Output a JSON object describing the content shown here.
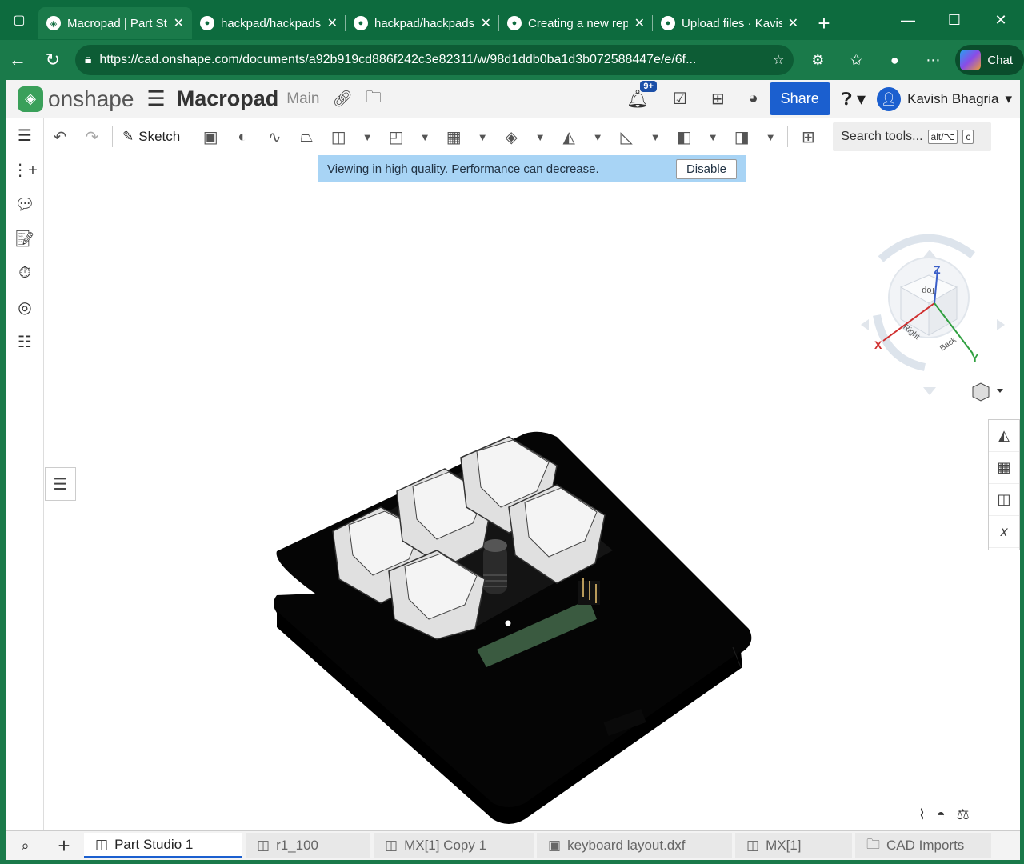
{
  "browser": {
    "tabs": [
      {
        "title": "Macropad | Part St",
        "active": true,
        "icon": "onshape-favicon"
      },
      {
        "title": "hackpad/hackpads",
        "active": false,
        "icon": "github-icon"
      },
      {
        "title": "hackpad/hackpads",
        "active": false,
        "icon": "github-icon"
      },
      {
        "title": "Creating a new rep",
        "active": false,
        "icon": "github-copilot-icon"
      },
      {
        "title": "Upload files · Kavis",
        "active": false,
        "icon": "github-icon"
      }
    ],
    "url": "https://cad.onshape.com/documents/a92b919cd886f242c3e82311/w/98d1ddb0ba1d3b072588447e/e/6f...",
    "chat_label": "Chat"
  },
  "header": {
    "logo_text": "onshape",
    "doc_title": "Macropad",
    "branch": "Main",
    "notif_badge": "9+",
    "share_label": "Share",
    "user_name": "Kavish Bhagria"
  },
  "toolbar": {
    "sketch_label": "Sketch",
    "search_label": "Search tools...",
    "search_kbd1": "alt/⌥",
    "search_kbd2": "c"
  },
  "banner": {
    "message": "Viewing in high quality. Performance can decrease.",
    "disable_label": "Disable"
  },
  "view_cube": {
    "axes": {
      "x": "X",
      "y": "Y",
      "z": "Z"
    },
    "faces": {
      "top": "Top",
      "right": "Right",
      "back": "Back"
    }
  },
  "bottom_tabs": [
    {
      "label": "Part Studio 1",
      "active": true
    },
    {
      "label": "r1_100",
      "active": false
    },
    {
      "label": "MX[1] Copy 1",
      "active": false
    },
    {
      "label": "keyboard layout.dxf",
      "active": false
    },
    {
      "label": "MX[1]",
      "active": false
    },
    {
      "label": "CAD Imports",
      "active": false
    }
  ],
  "colors": {
    "browser_green": "#1a7a4a",
    "share_blue": "#1b5fcf",
    "banner_blue": "#a8d4f5"
  }
}
